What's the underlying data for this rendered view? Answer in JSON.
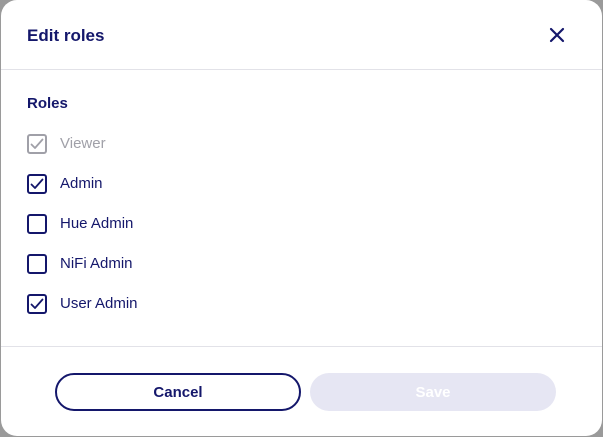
{
  "dialog": {
    "title": "Edit roles",
    "section_label": "Roles"
  },
  "roles": [
    {
      "label": "Viewer",
      "checked": true,
      "disabled": true
    },
    {
      "label": "Admin",
      "checked": true,
      "disabled": false
    },
    {
      "label": "Hue Admin",
      "checked": false,
      "disabled": false
    },
    {
      "label": "NiFi Admin",
      "checked": false,
      "disabled": false
    },
    {
      "label": "User Admin",
      "checked": true,
      "disabled": false
    }
  ],
  "footer": {
    "cancel_label": "Cancel",
    "save_label": "Save",
    "save_enabled": false
  },
  "colors": {
    "primary": "#14176b",
    "disabled": "#a0a0a8",
    "save_disabled_bg": "#e6e6f3"
  },
  "icons": {
    "close": "close-icon",
    "check": "checkmark-icon"
  }
}
